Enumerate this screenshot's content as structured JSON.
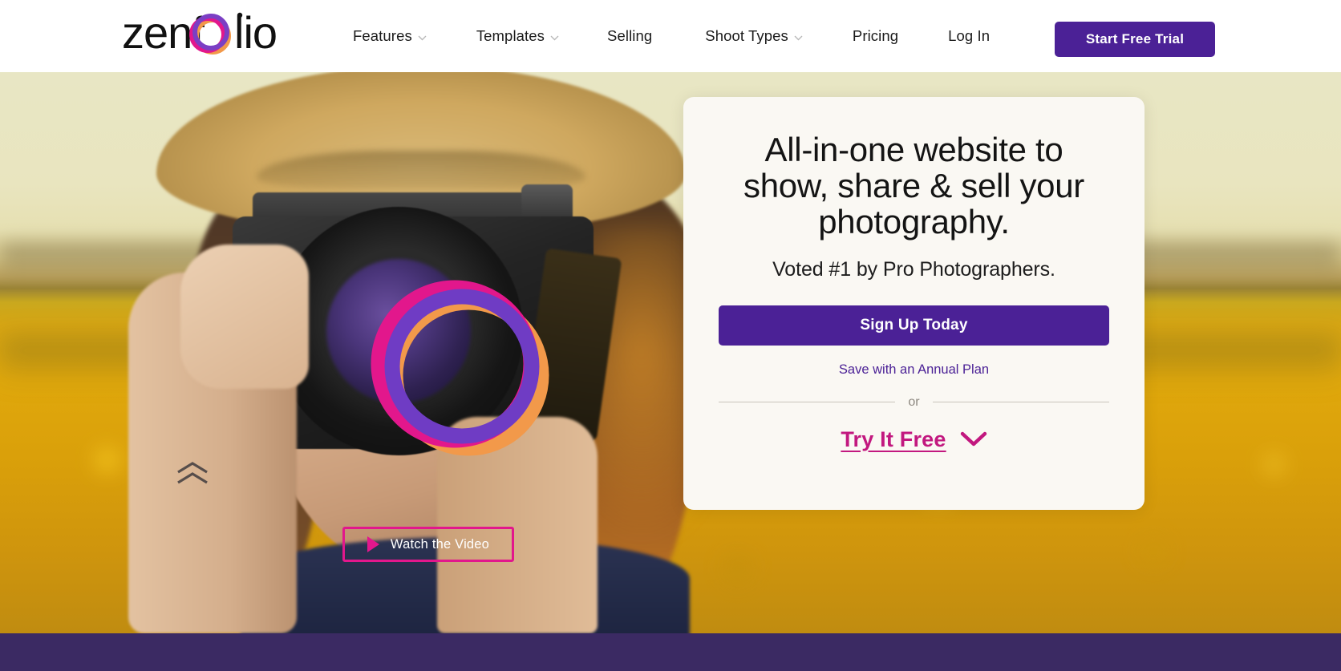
{
  "brand": {
    "name": "zenfolio",
    "logo_colors": {
      "purple": "#7B3FC4",
      "magenta": "#E2178C",
      "orange": "#F2994A"
    }
  },
  "theme": {
    "primary_purple": "#4B2196",
    "accent_magenta": "#C2187F",
    "card_bg": "#FAF8F3",
    "footer_purple": "#3B2A63"
  },
  "nav": {
    "items": [
      {
        "label": "Features",
        "has_dropdown": true,
        "icon": "chevron-down-icon"
      },
      {
        "label": "Templates",
        "has_dropdown": true,
        "icon": "chevron-down-icon"
      },
      {
        "label": "Selling",
        "has_dropdown": false,
        "icon": ""
      },
      {
        "label": "Shoot Types",
        "has_dropdown": true,
        "icon": "chevron-down-icon"
      },
      {
        "label": "Pricing",
        "has_dropdown": false,
        "icon": ""
      },
      {
        "label": "Log In",
        "has_dropdown": false,
        "icon": ""
      }
    ],
    "cta_label": "Start Free Trial"
  },
  "hero": {
    "watch_video": {
      "label": "Watch the Video",
      "icon": "play-icon"
    },
    "card": {
      "headline": "All-in-one website to show, share & sell your photography.",
      "subheadline": "Voted #1 by Pro Photographers.",
      "signup_label": "Sign Up Today",
      "annual_link": "Save with an Annual Plan",
      "divider_text": "or",
      "try_free_label": "Try It Free",
      "try_free_icon": "chevron-down-icon"
    }
  }
}
